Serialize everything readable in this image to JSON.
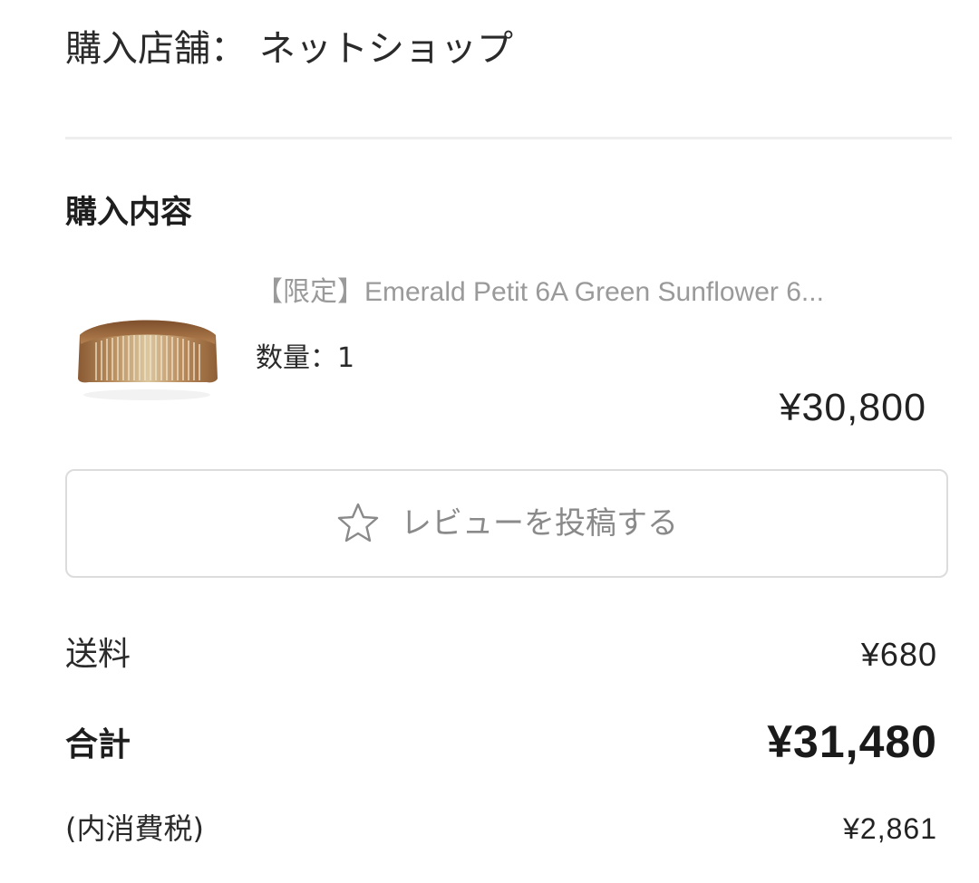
{
  "store": {
    "label": "購入店舗：",
    "value": "ネットショップ"
  },
  "purchase": {
    "section_title": "購入内容",
    "item": {
      "image_icon": "comb-product-image",
      "name": "【限定】Emerald Petit 6A Green Sunflower 6...",
      "quantity_label": "数量：1",
      "price": "¥30,800"
    }
  },
  "review": {
    "icon": "star-outline-icon",
    "label": "レビューを投稿する"
  },
  "summary": {
    "shipping_label": "送料",
    "shipping_value": "¥680",
    "total_label": "合計",
    "total_value": "¥31,480",
    "tax_label": "(内消費税)",
    "tax_value": "¥2,861"
  },
  "colors": {
    "text": "#222222",
    "muted": "#9a9a9a",
    "border": "#dcdcdc",
    "divider": "#eeeeee"
  }
}
